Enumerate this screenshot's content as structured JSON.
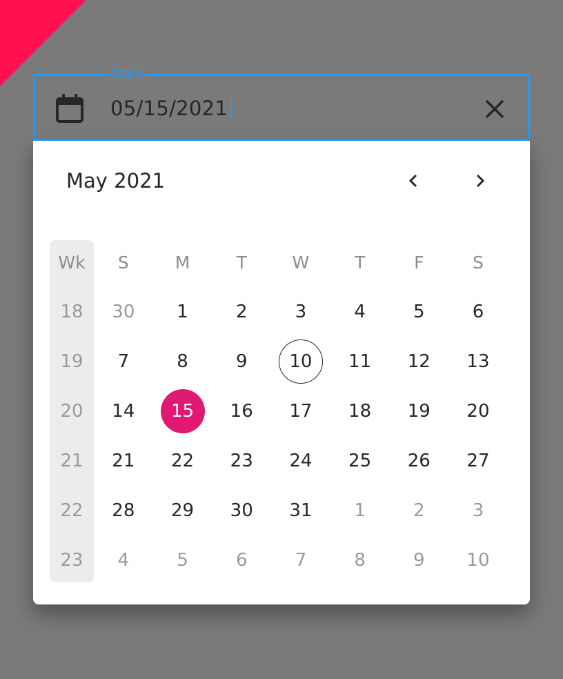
{
  "field": {
    "label": "Date",
    "value": "05/15/2021"
  },
  "calendar": {
    "month_title": "May 2021",
    "week_header": "Wk",
    "weekdays": [
      "S",
      "M",
      "T",
      "W",
      "T",
      "F",
      "S"
    ],
    "weeks": [
      {
        "wk": "18",
        "days": [
          {
            "label": "30",
            "other": true
          },
          {
            "label": "1"
          },
          {
            "label": "2"
          },
          {
            "label": "3"
          },
          {
            "label": "4"
          },
          {
            "label": "5"
          },
          {
            "label": "6"
          }
        ]
      },
      {
        "wk": "19",
        "days": [
          {
            "label": "7"
          },
          {
            "label": "8"
          },
          {
            "label": "9"
          },
          {
            "label": "10",
            "today": true
          },
          {
            "label": "11"
          },
          {
            "label": "12"
          },
          {
            "label": "13"
          }
        ]
      },
      {
        "wk": "20",
        "days": [
          {
            "label": "14"
          },
          {
            "label": "15",
            "selected": true
          },
          {
            "label": "16"
          },
          {
            "label": "17"
          },
          {
            "label": "18"
          },
          {
            "label": "19"
          },
          {
            "label": "20"
          }
        ]
      },
      {
        "wk": "21",
        "days": [
          {
            "label": "21"
          },
          {
            "label": "22"
          },
          {
            "label": "23"
          },
          {
            "label": "24"
          },
          {
            "label": "25"
          },
          {
            "label": "26"
          },
          {
            "label": "27"
          }
        ]
      },
      {
        "wk": "22",
        "days": [
          {
            "label": "28"
          },
          {
            "label": "29"
          },
          {
            "label": "30"
          },
          {
            "label": "31"
          },
          {
            "label": "1",
            "other": true
          },
          {
            "label": "2",
            "other": true
          },
          {
            "label": "3",
            "other": true
          }
        ]
      },
      {
        "wk": "23",
        "days": [
          {
            "label": "4",
            "other": true
          },
          {
            "label": "5",
            "other": true
          },
          {
            "label": "6",
            "other": true
          },
          {
            "label": "7",
            "other": true
          },
          {
            "label": "8",
            "other": true
          },
          {
            "label": "9",
            "other": true
          },
          {
            "label": "10",
            "other": true
          }
        ]
      }
    ]
  },
  "icons": {
    "field_icon": "calendar-icon",
    "clear": "close-icon",
    "prev": "chevron-left-icon",
    "next": "chevron-right-icon"
  },
  "colors": {
    "focus": "#1e9bff",
    "selected": "#e01a73",
    "corner": "#ff1150"
  }
}
